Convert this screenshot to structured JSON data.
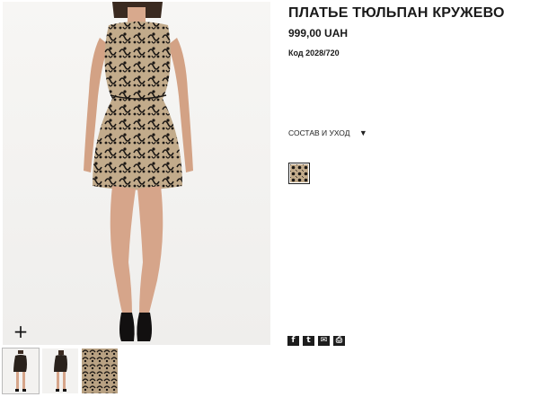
{
  "product": {
    "title": "ПЛАТЬЕ ТЮЛЬПАН КРУЖЕВО",
    "price": "999,00 UAH",
    "code": "Код 2028/720"
  },
  "composition": {
    "label": "СОСТАВ И УХОД",
    "arrow": "▼"
  },
  "zoom": {
    "label": "+"
  },
  "share": [
    {
      "name": "facebook-icon",
      "glyph": "f"
    },
    {
      "name": "twitter-icon",
      "glyph": "t"
    },
    {
      "name": "email-icon",
      "glyph": "✉"
    },
    {
      "name": "print-icon",
      "glyph": "⎙"
    }
  ],
  "colors": {
    "text": "#1a1a1a",
    "dress_base": "#bfa98a",
    "lace": "#1b1714",
    "skin": "#d6a58a",
    "shoes": "#121010"
  }
}
